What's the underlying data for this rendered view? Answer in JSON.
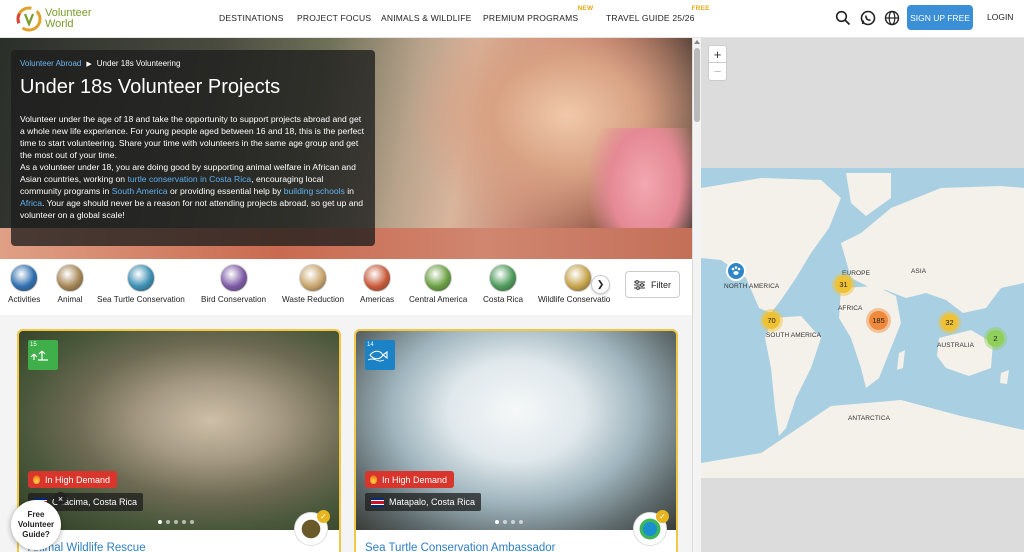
{
  "header": {
    "logo_line1": "Volunteer",
    "logo_line2": "World",
    "nav": [
      {
        "label": "DESTINATIONS",
        "badge": ""
      },
      {
        "label": "PROJECT FOCUS",
        "badge": ""
      },
      {
        "label": "ANIMALS & WILDLIFE",
        "badge": ""
      },
      {
        "label": "PREMIUM PROGRAMS",
        "badge": "NEW"
      },
      {
        "label": "TRAVEL GUIDE 25/26",
        "badge": "FREE"
      }
    ],
    "icons": [
      "search-icon",
      "whatsapp-icon",
      "globe-icon"
    ],
    "signup_label": "SIGN UP FREE",
    "login_label": "LOGIN"
  },
  "hero": {
    "breadcrumb_parent": "Volunteer Abroad",
    "breadcrumb_current": "Under 18s Volunteering",
    "title": "Under 18s Volunteer Projects",
    "p1": "Volunteer under the age of 18 and take the opportunity to support projects abroad and get a whole new life experience. For young people aged between 16 and 18, this is the perfect time to start volunteering. Share your time with volunteers in the same age group and get the most out of your time.",
    "p2_a": "As a volunteer under 18, you are doing good by supporting animal welfare in African and Asian countries, working on ",
    "p2_link1": "turtle conservation in Costa Rica",
    "p2_b": ", encouraging local community programs in ",
    "p2_link2": "South America",
    "p2_c": " or providing essential help by ",
    "p2_link3": "building schools",
    "p2_d": " in ",
    "p2_link4": "Africa",
    "p2_e": ". Your age should never be a reason for not attending projects abroad, so get up and volunteer on a global scale!"
  },
  "categories": [
    {
      "label": "Activities",
      "color": "#2f6fb0"
    },
    {
      "label": "Animal",
      "color": "#a58554"
    },
    {
      "label": "Sea Turtle Conservation",
      "color": "#3b8fb3"
    },
    {
      "label": "Bird Conservation",
      "color": "#7e5aa6"
    },
    {
      "label": "Waste Reduction",
      "color": "#c9a46c"
    },
    {
      "label": "Americas",
      "color": "#c95a3a"
    },
    {
      "label": "Central America",
      "color": "#6aa042"
    },
    {
      "label": "Costa Rica",
      "color": "#4d9a5a"
    },
    {
      "label": "Wildlife Conservation",
      "color": "#c7a34b"
    }
  ],
  "filter_label": "Filter",
  "cards": [
    {
      "sdg_number": "15",
      "sdg_color": "#3eaf49",
      "demand": "In High Demand",
      "location": "Guácima, Costa Rica",
      "title": "Animal Wildlife Rescue"
    },
    {
      "sdg_number": "14",
      "sdg_color": "#1b82c5",
      "demand": "In High Demand",
      "location": "Matapalo, Costa Rica",
      "title": "Sea Turtle Conservation Ambassador"
    }
  ],
  "guide": {
    "line1": "Free",
    "line2": "Volunteer",
    "line3": "Guide?",
    "close": "×"
  },
  "map": {
    "zoom_in": "+",
    "zoom_out": "−",
    "labels": [
      "NORTH AMERICA",
      "EUROPE",
      "ASIA",
      "AFRICA",
      "SOUTH AMERICA",
      "AUSTRALIA",
      "ANTARCTICA"
    ],
    "clusters": [
      {
        "count": "31",
        "color": "#f0c233"
      },
      {
        "count": "70",
        "color": "#f0c233"
      },
      {
        "count": "185",
        "color": "#f08a3a"
      },
      {
        "count": "32",
        "color": "#f0c233"
      },
      {
        "count": "2",
        "color": "#8fcf5a"
      }
    ],
    "ocean_color": "#a9cfe2",
    "land_color": "#f4f1ea"
  }
}
